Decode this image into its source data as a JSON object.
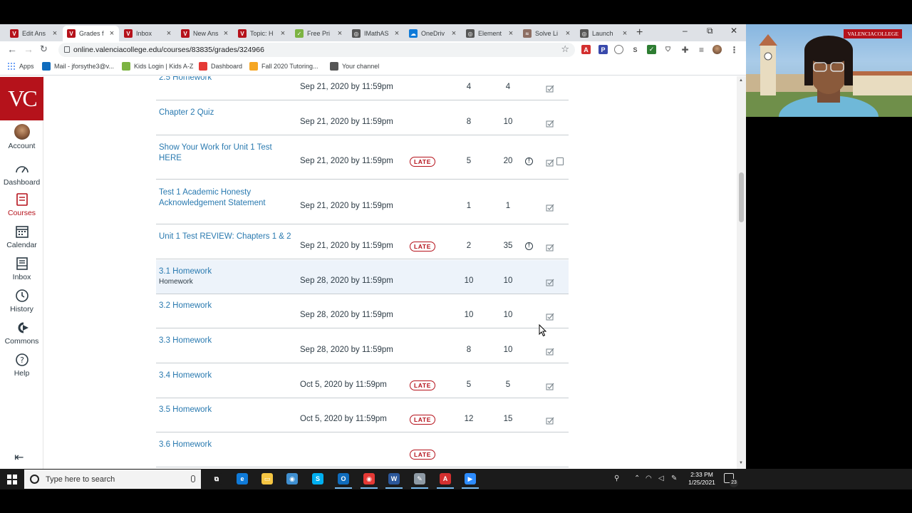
{
  "browser": {
    "tabs": [
      {
        "label": "Edit Ans",
        "fav_color": "#b5121b",
        "fav_glyph": "V"
      },
      {
        "label": "Grades f",
        "fav_color": "#b5121b",
        "fav_glyph": "V"
      },
      {
        "label": "Inbox",
        "fav_color": "#b5121b",
        "fav_glyph": "V"
      },
      {
        "label": "New Ans",
        "fav_color": "#b5121b",
        "fav_glyph": "V"
      },
      {
        "label": "Topic: H",
        "fav_color": "#b5121b",
        "fav_glyph": "V"
      },
      {
        "label": "Free Pri",
        "fav_color": "#7cb342",
        "fav_glyph": "✓"
      },
      {
        "label": "IMathAS",
        "fav_color": "#555555",
        "fav_glyph": "◎"
      },
      {
        "label": "OneDriv",
        "fav_color": "#0f7ad8",
        "fav_glyph": "☁"
      },
      {
        "label": "Element",
        "fav_color": "#555555",
        "fav_glyph": "◎"
      },
      {
        "label": "Solve Li",
        "fav_color": "#8d6e63",
        "fav_glyph": "≈"
      },
      {
        "label": "Launch",
        "fav_color": "#555555",
        "fav_glyph": "◎"
      }
    ],
    "active_tab_index": 1,
    "new_tab": "+",
    "window_controls": {
      "minimize": "–",
      "restore": "⧉",
      "close": "✕"
    },
    "url": "online.valenciacollege.edu/courses/83835/grades/324966",
    "bookmarks": [
      {
        "label": "Apps",
        "icon_color": "#4285f4"
      },
      {
        "label": "Mail - jforsythe3@v...",
        "icon_color": "#0f6cbd"
      },
      {
        "label": "Kids Login | Kids A-Z",
        "icon_color": "#7cb342"
      },
      {
        "label": "Dashboard",
        "icon_color": "#e53935"
      },
      {
        "label": "Fall 2020 Tutoring...",
        "icon_color": "#f5a623"
      },
      {
        "label": "Your channel",
        "icon_color": "#555555"
      }
    ]
  },
  "canvas_nav": {
    "logo": "VC",
    "items": [
      {
        "label": "Account",
        "icon": "account-avatar-icon"
      },
      {
        "label": "Dashboard",
        "icon": "dashboard-icon"
      },
      {
        "label": "Courses",
        "icon": "courses-icon",
        "active": true
      },
      {
        "label": "Calendar",
        "icon": "calendar-icon"
      },
      {
        "label": "Inbox",
        "icon": "inbox-icon"
      },
      {
        "label": "History",
        "icon": "history-icon"
      },
      {
        "label": "Commons",
        "icon": "commons-icon"
      },
      {
        "label": "Help",
        "icon": "help-icon"
      }
    ],
    "collapse_icon": "collapse-nav-icon"
  },
  "grades": {
    "late_label": "LATE",
    "rows": [
      {
        "name": "2.5 Homework",
        "due": "Sep 21, 2020 by 11:59pm",
        "late": false,
        "score": "4",
        "possible": "4",
        "comment": false,
        "note": false
      },
      {
        "name": "Chapter 2 Quiz",
        "due": "Sep 21, 2020 by 11:59pm",
        "late": false,
        "score": "8",
        "possible": "10",
        "comment": false,
        "note": false
      },
      {
        "name": "Show Your Work for Unit 1 Test HERE",
        "due": "Sep 21, 2020 by 11:59pm",
        "late": true,
        "score": "5",
        "possible": "20",
        "comment": true,
        "note": true
      },
      {
        "name": "Test 1 Academic Honesty Acknowledgement Statement",
        "due": "Sep 21, 2020 by 11:59pm",
        "late": false,
        "score": "1",
        "possible": "1",
        "comment": false,
        "note": false
      },
      {
        "name": "Unit 1 Test REVIEW: Chapters 1 & 2",
        "due": "Sep 21, 2020 by 11:59pm",
        "late": true,
        "score": "2",
        "possible": "35",
        "comment": true,
        "note": false
      },
      {
        "name": "3.1 Homework",
        "sub": "Homework",
        "due": "Sep 28, 2020 by 11:59pm",
        "late": false,
        "score": "10",
        "possible": "10",
        "comment": false,
        "note": false,
        "highlight": true
      },
      {
        "name": "3.2 Homework",
        "due": "Sep 28, 2020 by 11:59pm",
        "late": false,
        "score": "10",
        "possible": "10",
        "comment": false,
        "note": false
      },
      {
        "name": "3.3 Homework",
        "due": "Sep 28, 2020 by 11:59pm",
        "late": false,
        "score": "8",
        "possible": "10",
        "comment": false,
        "note": false
      },
      {
        "name": "3.4 Homework",
        "due": "Oct 5, 2020 by 11:59pm",
        "late": true,
        "score": "5",
        "possible": "5",
        "comment": false,
        "note": false
      },
      {
        "name": "3.5 Homework",
        "due": "Oct 5, 2020 by 11:59pm",
        "late": true,
        "score": "12",
        "possible": "15",
        "comment": false,
        "note": false
      },
      {
        "name": "3.6 Homework",
        "due": "",
        "late": true,
        "score": "",
        "possible": "",
        "comment": false,
        "note": false
      }
    ]
  },
  "webcam": {
    "badge": "VALENCIACOLLEGE"
  },
  "taskbar": {
    "search_placeholder": "Type here to search",
    "apps": [
      {
        "name": "task-view-icon",
        "color": "#1b1b1b",
        "glyph": "⧉"
      },
      {
        "name": "edge-icon",
        "color": "#0f7ad8",
        "glyph": "e"
      },
      {
        "name": "file-explorer-icon",
        "color": "#f5c542",
        "glyph": "▭"
      },
      {
        "name": "globe-app-icon",
        "color": "#3f8fd0",
        "glyph": "◉"
      },
      {
        "name": "skype-icon",
        "color": "#00aff0",
        "glyph": "S"
      },
      {
        "name": "outlook-icon",
        "color": "#0f6cbd",
        "glyph": "O"
      },
      {
        "name": "chrome-icon",
        "color": "#e53935",
        "glyph": "◉"
      },
      {
        "name": "word-icon",
        "color": "#2b579a",
        "glyph": "W"
      },
      {
        "name": "paint-app-icon",
        "color": "#8e9aa5",
        "glyph": "✎"
      },
      {
        "name": "acrobat-icon",
        "color": "#d32f2f",
        "glyph": "A"
      },
      {
        "name": "zoom-icon",
        "color": "#2d8cff",
        "glyph": "▶"
      }
    ],
    "time": "2:33 PM",
    "date": "1/25/2021",
    "notification_count": "23"
  }
}
